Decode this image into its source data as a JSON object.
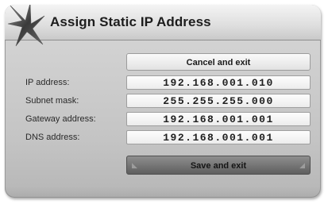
{
  "dialog": {
    "title": "Assign Static IP Address",
    "logo_icon": "x-logo-icon"
  },
  "buttons": {
    "cancel_label": "Cancel and exit",
    "save_label": "Save and exit"
  },
  "fields": [
    {
      "label": "IP address:",
      "value": "192.168.001.010"
    },
    {
      "label": "Subnet mask:",
      "value": "255.255.255.000"
    },
    {
      "label": "Gateway address:",
      "value": "192.168.001.001"
    },
    {
      "label": "DNS address:",
      "value": "192.168.001.001"
    }
  ]
}
